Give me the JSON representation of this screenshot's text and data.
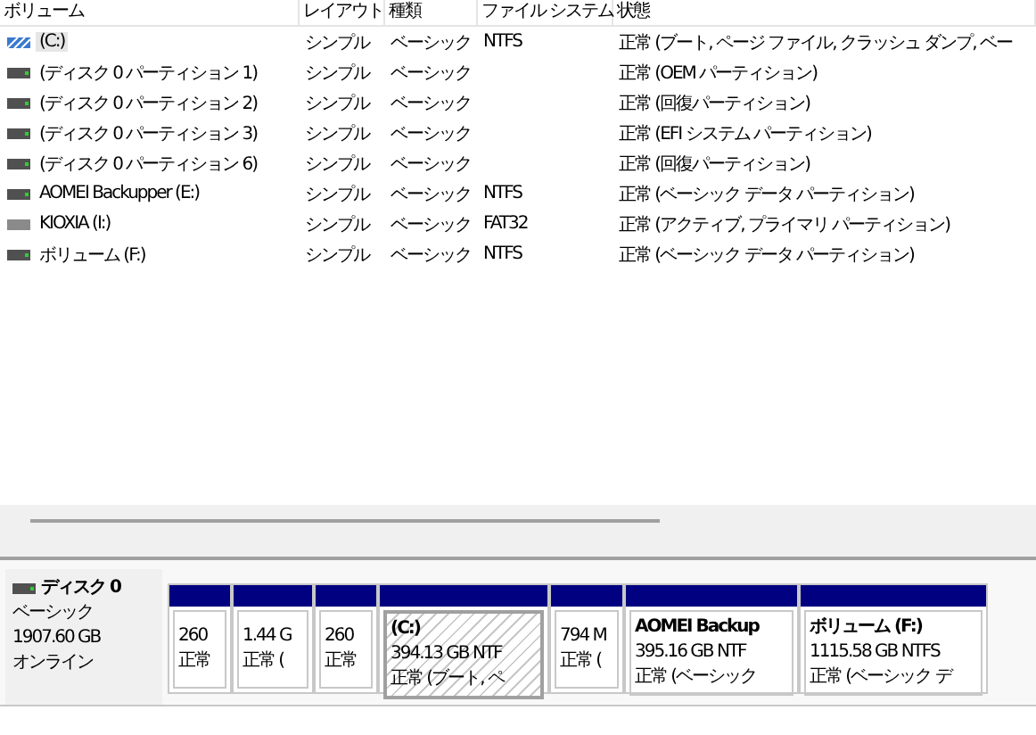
{
  "columns": [
    {
      "label": "ボリューム"
    },
    {
      "label": "レイアウト"
    },
    {
      "label": "種類"
    },
    {
      "label": "ファイル システム"
    },
    {
      "label": "状態"
    }
  ],
  "volumes": [
    {
      "kind": "system",
      "name": "(C:)",
      "layout": "シンプル",
      "type": "ベーシック",
      "filesystem": "NTFS",
      "status": "正常 (ブート, ページ ファイル, クラッシュ ダンプ, ベー",
      "selected": true
    },
    {
      "kind": "drive",
      "name": "(ディスク 0 パーティション 1)",
      "layout": "シンプル",
      "type": "ベーシック",
      "status": "正常 (OEM パーティション)",
      "selected": false
    },
    {
      "kind": "drive",
      "name": "(ディスク 0 パーティション 2)",
      "layout": "シンプル",
      "type": "ベーシック",
      "status": "正常 (回復パーティション)",
      "selected": false
    },
    {
      "kind": "drive",
      "name": "(ディスク 0 パーティション 3)",
      "layout": "シンプル",
      "type": "ベーシック",
      "status": "正常 (EFI システム パーティション)",
      "selected": false
    },
    {
      "kind": "drive",
      "name": "(ディスク 0 パーティション 6)",
      "layout": "シンプル",
      "type": "ベーシック",
      "status": "正常 (回復パーティション)",
      "selected": false
    },
    {
      "kind": "drive",
      "name": "AOMEI Backupper (E:)",
      "layout": "シンプル",
      "type": "ベーシック",
      "filesystem": "NTFS",
      "status": "正常 (ベーシック データ パーティション)",
      "selected": false
    },
    {
      "kind": "removable",
      "name": "KIOXIA (I:)",
      "layout": "シンプル",
      "type": "ベーシック",
      "filesystem": "FAT32",
      "status": "正常 (アクティブ, プライマリ パーティション)",
      "selected": false
    },
    {
      "kind": "drive",
      "name": "ボリューム (F:)",
      "layout": "シンプル",
      "type": "ベーシック",
      "filesystem": "NTFS",
      "status": "正常 (ベーシック データ パーティション)",
      "selected": false
    }
  ],
  "disk": {
    "label": "ディスク 0",
    "type": "ベーシック",
    "size": "1907.60 GB",
    "status": "オンライン",
    "partitions": [
      {
        "size": "260",
        "status": "正常",
        "selected": false
      },
      {
        "size": "1.44 G",
        "status": "正常 (",
        "selected": false
      },
      {
        "size": "260",
        "status": "正常",
        "selected": false
      },
      {
        "name": "(C:)",
        "size": "394.13 GB NTF",
        "status": "正常 (ブート, ペ",
        "selected": true
      },
      {
        "size": "794 M",
        "status": "正常 (",
        "selected": false
      },
      {
        "name": "AOMEI Backup",
        "size": "395.16 GB NTF",
        "status": "正常 (ベーシック",
        "selected": false
      },
      {
        "name": "ボリューム (F:)",
        "size": "1115.58 GB NTFS",
        "status": "正常 (ベーシック デ",
        "selected": false
      }
    ]
  }
}
